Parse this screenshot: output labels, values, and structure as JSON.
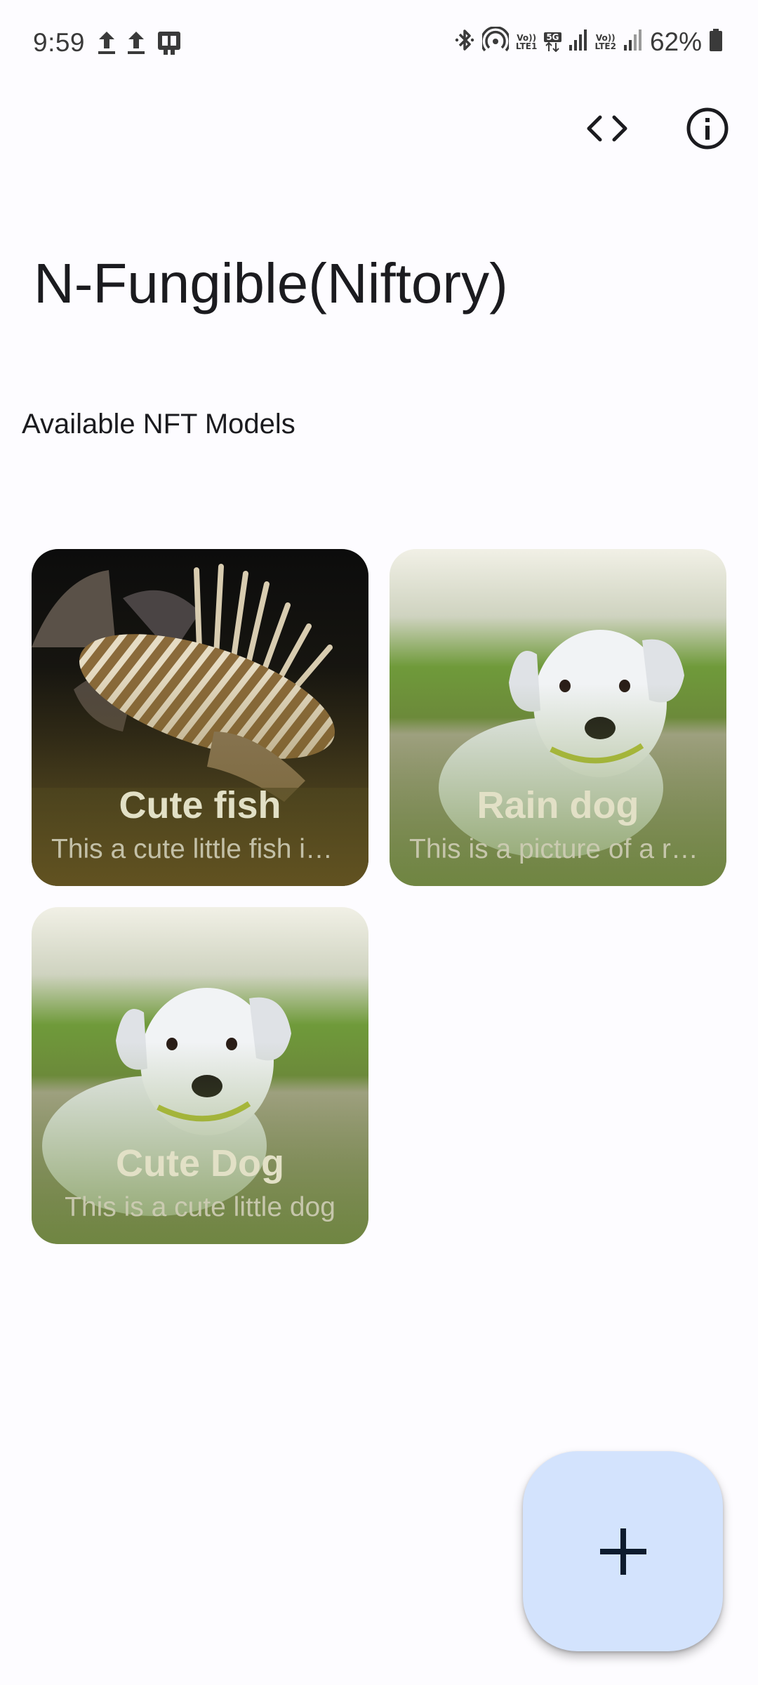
{
  "status_bar": {
    "time": "9:59",
    "network_badge_top": "Vo))",
    "network_badge_lte1": "LTE1",
    "network_badge_5g": "5G",
    "network_badge_lte2": "LTE2",
    "battery_percent": "62%",
    "icons": [
      "upload-icon",
      "upload-icon",
      "sim-card-icon",
      "bluetooth-icon",
      "hotspot-icon",
      "signal-icon",
      "battery-icon"
    ]
  },
  "toolbar": {
    "code_icon": "code-icon",
    "info_icon": "info-icon"
  },
  "app": {
    "title": "N-Fungible(Niftory)"
  },
  "section": {
    "title": "Available NFT Models"
  },
  "cards": [
    {
      "title": "Cute fish",
      "description": "This a cute little fish image",
      "image": "lionfish-image"
    },
    {
      "title": "Rain dog",
      "description": "This is a picture of a rain dog",
      "image": "puppy-image"
    },
    {
      "title": "Cute Dog",
      "description": "This is a cute little dog",
      "image": "puppy-image"
    }
  ],
  "fab": {
    "icon": "plus-icon"
  },
  "colors": {
    "background": "#fdfcff",
    "fab": "#d3e3fd",
    "card_text": "#e2e0c6",
    "fish_card_tint": "#6e5a22",
    "dog_card_tint": "#6c8a3a"
  }
}
